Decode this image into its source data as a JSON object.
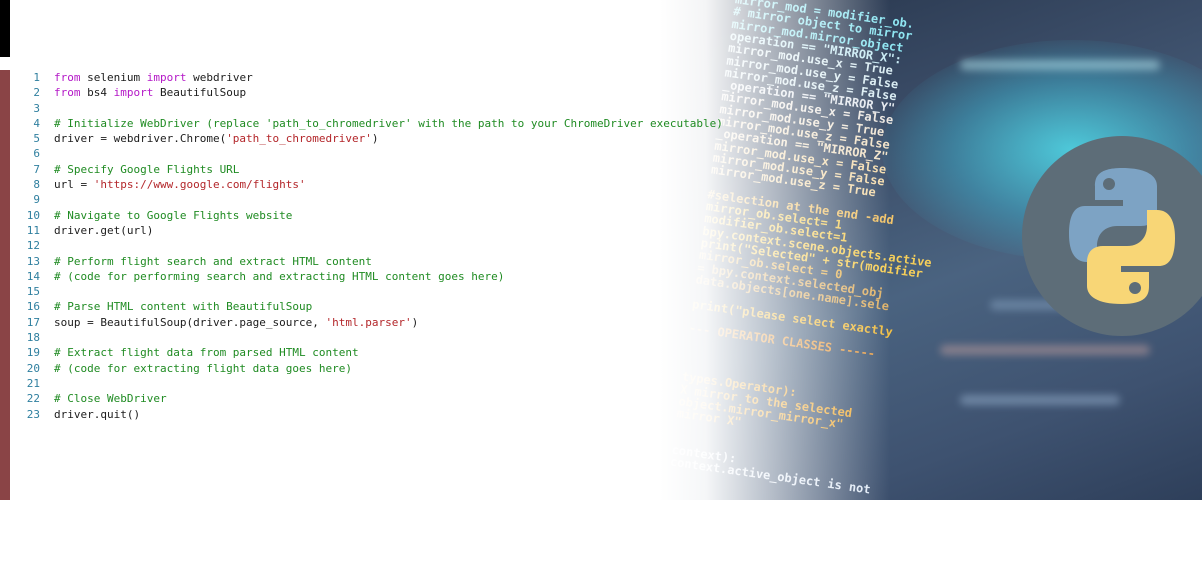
{
  "editor": {
    "lines": [
      {
        "n": "1",
        "tokens": [
          {
            "t": "kw",
            "v": "from"
          },
          {
            "t": "pl",
            "v": " selenium "
          },
          {
            "t": "kw",
            "v": "import"
          },
          {
            "t": "pl",
            "v": " webdriver"
          }
        ]
      },
      {
        "n": "2",
        "tokens": [
          {
            "t": "kw",
            "v": "from"
          },
          {
            "t": "pl",
            "v": " bs4 "
          },
          {
            "t": "kw",
            "v": "import"
          },
          {
            "t": "pl",
            "v": " BeautifulSoup"
          }
        ]
      },
      {
        "n": "3",
        "tokens": []
      },
      {
        "n": "4",
        "tokens": [
          {
            "t": "cm",
            "v": "# Initialize WebDriver (replace 'path_to_chromedriver' with the path to your ChromeDriver executable)"
          }
        ]
      },
      {
        "n": "5",
        "tokens": [
          {
            "t": "pl",
            "v": "driver = webdriver.Chrome("
          },
          {
            "t": "str",
            "v": "'path_to_chromedriver'"
          },
          {
            "t": "pl",
            "v": ")"
          }
        ]
      },
      {
        "n": "6",
        "tokens": []
      },
      {
        "n": "7",
        "tokens": [
          {
            "t": "cm",
            "v": "# Specify Google Flights URL"
          }
        ]
      },
      {
        "n": "8",
        "tokens": [
          {
            "t": "pl",
            "v": "url = "
          },
          {
            "t": "str",
            "v": "'https://www.google.com/flights'"
          }
        ]
      },
      {
        "n": "9",
        "tokens": []
      },
      {
        "n": "10",
        "tokens": [
          {
            "t": "cm",
            "v": "# Navigate to Google Flights website"
          }
        ]
      },
      {
        "n": "11",
        "tokens": [
          {
            "t": "pl",
            "v": "driver.get(url)"
          }
        ]
      },
      {
        "n": "12",
        "tokens": []
      },
      {
        "n": "13",
        "tokens": [
          {
            "t": "cm",
            "v": "# Perform flight search and extract HTML content"
          }
        ]
      },
      {
        "n": "14",
        "tokens": [
          {
            "t": "cm",
            "v": "# (code for performing search and extracting HTML content goes here)"
          }
        ]
      },
      {
        "n": "15",
        "tokens": []
      },
      {
        "n": "16",
        "tokens": [
          {
            "t": "cm",
            "v": "# Parse HTML content with BeautifulSoup"
          }
        ]
      },
      {
        "n": "17",
        "tokens": [
          {
            "t": "pl",
            "v": "soup = BeautifulSoup(driver.page_source, "
          },
          {
            "t": "str",
            "v": "'html.parser'"
          },
          {
            "t": "pl",
            "v": ")"
          }
        ]
      },
      {
        "n": "18",
        "tokens": []
      },
      {
        "n": "19",
        "tokens": [
          {
            "t": "cm",
            "v": "# Extract flight data from parsed HTML content"
          }
        ]
      },
      {
        "n": "20",
        "tokens": [
          {
            "t": "cm",
            "v": "# (code for extracting flight data goes here)"
          }
        ]
      },
      {
        "n": "21",
        "tokens": []
      },
      {
        "n": "22",
        "tokens": [
          {
            "t": "cm",
            "v": "# Close WebDriver"
          }
        ]
      },
      {
        "n": "23",
        "tokens": [
          {
            "t": "pl",
            "v": "driver.quit()"
          }
        ]
      }
    ]
  },
  "background_code": [
    {
      "text": "mirror_mod = modifier_ob.",
      "color": "#8fe6f2"
    },
    {
      "text": "# mirror object to mirror",
      "color": "#8fe6f2"
    },
    {
      "text": "mirror_mod.mirror_object",
      "color": "#8fe6f2"
    },
    {
      "text": "operation == \"MIRROR_X\":",
      "color": "#c9ecf5"
    },
    {
      "text": "mirror_mod.use_x = True",
      "color": "#d9ecf2"
    },
    {
      "text": "mirror_mod.use_y = False",
      "color": "#d9ecf2"
    },
    {
      "text": "mirror_mod.use_z = False",
      "color": "#d9ecf2"
    },
    {
      "text": "_operation == \"MIRROR_Y\"",
      "color": "#e5eaf0"
    },
    {
      "text": "mirror_mod.use_x = False",
      "color": "#ede8e2"
    },
    {
      "text": "mirror_mod.use_y = True",
      "color": "#f0e6d6"
    },
    {
      "text": "mirror_mod.use_z = False",
      "color": "#f1e2c8"
    },
    {
      "text": "_operation == \"MIRROR_Z\"",
      "color": "#f1e2c8"
    },
    {
      "text": "mirror_mod.use_x = False",
      "color": "#f4dcae"
    },
    {
      "text": "mirror_mod.use_y = False",
      "color": "#f4dcae"
    },
    {
      "text": "mirror_mod.use_z = True",
      "color": "#f4dcae"
    },
    {
      "text": "",
      "color": "#f4d08a"
    },
    {
      "text": "#selection at the end -add",
      "color": "#f2c46a"
    },
    {
      "text": "mirror_ob.select= 1",
      "color": "#f6cf5a"
    },
    {
      "text": "modifier_ob.select=1",
      "color": "#f6cf5a"
    },
    {
      "text": "bpy.context.scene.objects.active",
      "color": "#f6cf5a"
    },
    {
      "text": "print(\"Selected\" + str(modifier",
      "color": "#f6cf5a"
    },
    {
      "text": "mirror_ob.select = 0",
      "color": "#e8b75a"
    },
    {
      "text": "= bpy.context.selected_obj",
      "color": "#dfb36a"
    },
    {
      "text": "data.objects[one.name].sele",
      "color": "#dfb36a"
    },
    {
      "text": "",
      "color": "#f2c046"
    },
    {
      "text": "print(\"please select exactly",
      "color": "#f2c046"
    },
    {
      "text": "",
      "color": "#e8a04a"
    },
    {
      "text": "--- OPERATOR CLASSES -----",
      "color": "#e8a04a"
    },
    {
      "text": "",
      "color": "#f2b848"
    },
    {
      "text": "",
      "color": "#f2b848"
    },
    {
      "text": "",
      "color": "#f2b848"
    },
    {
      "text": "types.Operator):",
      "color": "#f0b040"
    },
    {
      "text": "X mirror to the selected",
      "color": "#f0b040"
    },
    {
      "text": "object.mirror_mirror_x\"",
      "color": "#f0b040"
    },
    {
      "text": "mirror X\"",
      "color": "#f0b040"
    },
    {
      "text": "",
      "color": "#f0b040"
    },
    {
      "text": "",
      "color": "#f0b040"
    },
    {
      "text": "context):",
      "color": "#dfe9f5"
    },
    {
      "text": "context.active_object is not",
      "color": "#dfe9f5"
    }
  ],
  "logo": {
    "name": "python-logo",
    "colors": {
      "circle": "#5d6d78",
      "blue": "#7da3c4",
      "yellow": "#f8d676"
    }
  }
}
